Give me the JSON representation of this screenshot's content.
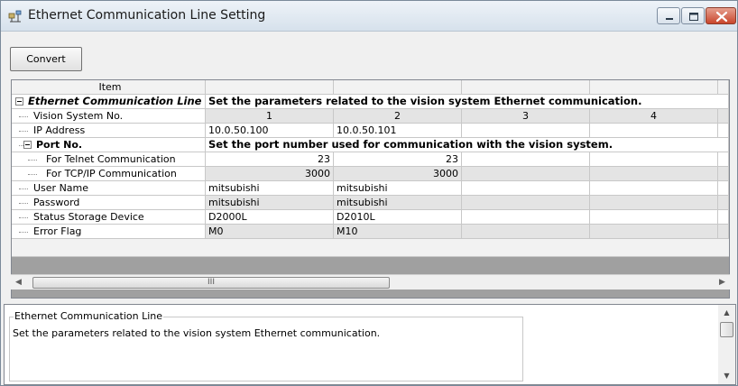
{
  "window": {
    "title": "Ethernet Communication Line Setting"
  },
  "toolbar": {
    "convert_label": "Convert"
  },
  "grid": {
    "header": {
      "item": "Item",
      "cols": [
        "",
        "",
        "",
        ""
      ]
    },
    "rows": {
      "ecl": {
        "label": "Ethernet Communication Line",
        "note": "Set the parameters related to the vision system Ethernet communication."
      },
      "vsn": {
        "label": "Vision System No.",
        "values": [
          "1",
          "2",
          "3",
          "4"
        ]
      },
      "ip": {
        "label": "IP Address",
        "values": [
          "10.0.50.100",
          "10.0.50.101",
          "",
          ""
        ]
      },
      "port": {
        "label": "Port No.",
        "note": "Set the port number used for communication with the vision system."
      },
      "telnet": {
        "label": "For Telnet Communication",
        "values": [
          "23",
          "23",
          "",
          ""
        ]
      },
      "tcpip": {
        "label": "For TCP/IP Communication",
        "values": [
          "3000",
          "3000",
          "",
          ""
        ]
      },
      "user": {
        "label": "User Name",
        "values": [
          "mitsubishi",
          "mitsubishi",
          "",
          ""
        ]
      },
      "password": {
        "label": "Password",
        "values": [
          "mitsubishi",
          "mitsubishi",
          "",
          ""
        ]
      },
      "storage": {
        "label": "Status Storage Device",
        "values": [
          "D2000L",
          "D2010L",
          "",
          ""
        ]
      },
      "error": {
        "label": "Error Flag",
        "values": [
          "M0",
          "M10",
          "",
          ""
        ]
      }
    },
    "hscroll_grip": "III"
  },
  "description": {
    "title": "Ethernet Communication Line",
    "text": "Set the parameters related to the vision system Ethernet communication."
  },
  "icons": {
    "window": "network-settings-icon",
    "minimize": "minimize-icon",
    "maximize": "maximize-icon",
    "close": "close-icon"
  },
  "colors": {
    "title_gradient_top": "#eef3f8",
    "close_button": "#c9462c",
    "grid_background": "#a0a0a0",
    "alt_row": "#e4e4e4"
  }
}
